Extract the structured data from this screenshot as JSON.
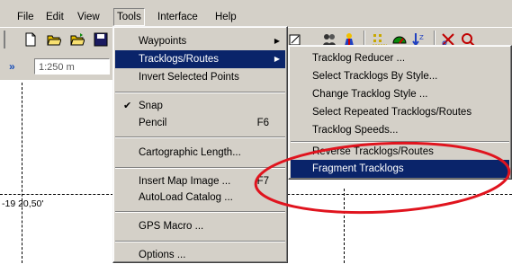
{
  "menubar": {
    "file": "File",
    "edit": "Edit",
    "view": "View",
    "tools": "Tools",
    "interface": "Interface",
    "help": "Help"
  },
  "toolbar": {
    "scale_value": "1:250 m"
  },
  "map": {
    "coordinate_label": "-19 20,50'"
  },
  "tools_menu": {
    "waypoints": "Waypoints",
    "tracklogs_routes": "Tracklogs/Routes",
    "invert_selected": "Invert Selected Points",
    "snap": "Snap",
    "pencil": "Pencil",
    "pencil_shortcut": "F6",
    "cartographic_length": "Cartographic Length...",
    "insert_map_image": "Insert Map Image ...",
    "insert_map_image_shortcut": "F7",
    "autoload_catalog": "AutoLoad Catalog ...",
    "gps_macro": "GPS Macro ...",
    "options": "Options ..."
  },
  "tracklogs_submenu": {
    "reducer": "Tracklog Reducer ...",
    "select_by_style": "Select Tracklogs By Style...",
    "change_style": "Change Tracklog Style ...",
    "select_repeated": "Select Repeated Tracklogs/Routes",
    "speeds": "Tracklog Speeds...",
    "reverse": "Reverse Tracklogs/Routes",
    "fragment": "Fragment Tracklogs"
  },
  "colors": {
    "menu_bg": "#d4d0c8",
    "highlight": "#0a246a",
    "callout": "#e0141e"
  }
}
